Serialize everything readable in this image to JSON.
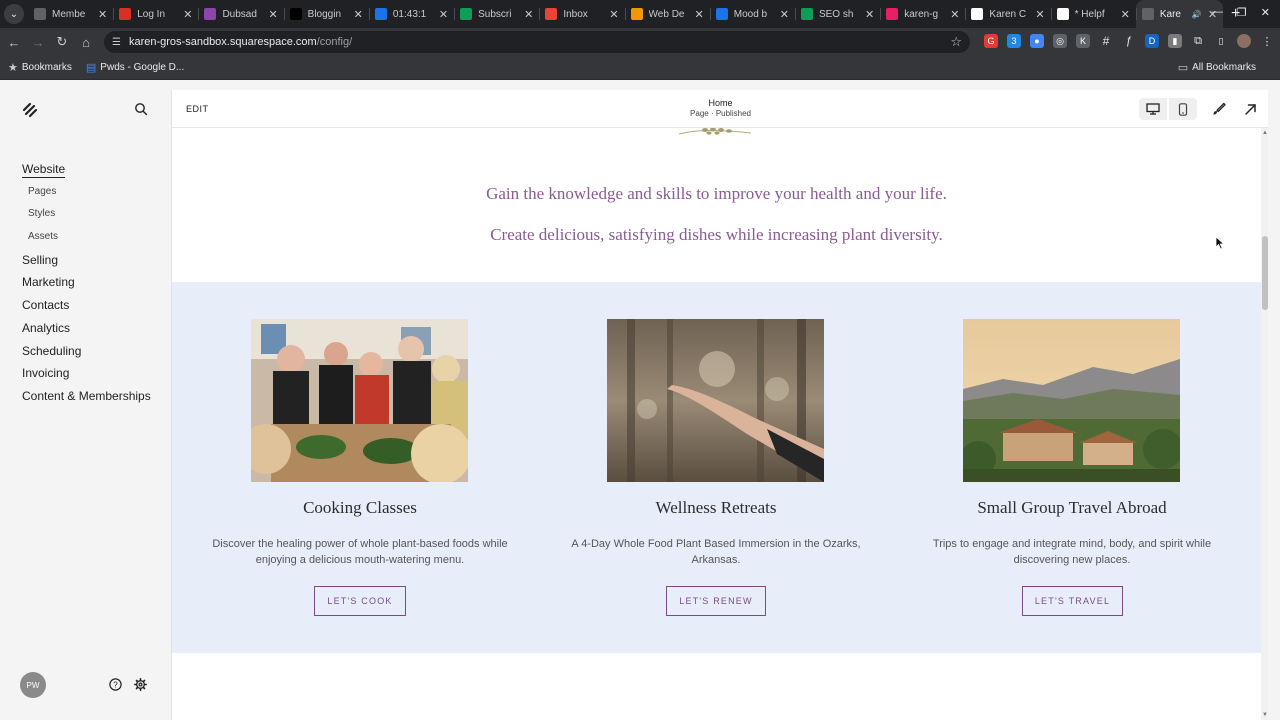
{
  "browser": {
    "tabs": [
      {
        "title": "Membe",
        "color": "#5f6368",
        "active": false
      },
      {
        "title": "Log In",
        "color": "#d93025",
        "active": false
      },
      {
        "title": "Dubsad",
        "color": "#8e44ad",
        "active": false
      },
      {
        "title": "Bloggin",
        "color": "#000000",
        "active": false
      },
      {
        "title": "01:43:1",
        "color": "#1a73e8",
        "active": false
      },
      {
        "title": "Subscri",
        "color": "#0f9d58",
        "active": false
      },
      {
        "title": "Inbox",
        "color": "#ea4335",
        "active": false
      },
      {
        "title": "Web De",
        "color": "#f29900",
        "active": false
      },
      {
        "title": "Mood b",
        "color": "#1a73e8",
        "active": false
      },
      {
        "title": "SEO sh",
        "color": "#0f9d58",
        "active": false
      },
      {
        "title": "karen-g",
        "color": "#e91e63",
        "active": false
      },
      {
        "title": "Karen C",
        "color": "#ffffff",
        "active": false
      },
      {
        "title": "* Helpf",
        "color": "#ffffff",
        "active": false
      },
      {
        "title": "Kare",
        "color": "#5f6368",
        "active": true
      }
    ],
    "url_host": "karen-gros-sandbox.squarespace.com",
    "url_path": "/config/",
    "bookmarks": {
      "bookmarks_label": "Bookmarks",
      "pwds_label": "Pwds - Google D...",
      "all_label": "All Bookmarks"
    }
  },
  "sidebar": {
    "items": [
      {
        "label": "Website",
        "active": true
      },
      {
        "label": "Pages",
        "sub": true
      },
      {
        "label": "Styles",
        "sub": true
      },
      {
        "label": "Assets",
        "sub": true
      },
      {
        "label": "Selling"
      },
      {
        "label": "Marketing"
      },
      {
        "label": "Contacts"
      },
      {
        "label": "Analytics"
      },
      {
        "label": "Scheduling"
      },
      {
        "label": "Invoicing"
      },
      {
        "label": "Content & Memberships"
      }
    ],
    "avatar_initials": "PW"
  },
  "editor": {
    "edit_label": "EDIT",
    "page_title": "Home",
    "page_status": "Page · Published"
  },
  "site": {
    "tagline_1": "Gain the knowledge and skills to improve your health and your life.",
    "tagline_2": "Create delicious, satisfying dishes while increasing plant diversity.",
    "cards": [
      {
        "title": "Cooking Classes",
        "description": "Discover the healing power of whole plant-based foods while enjoying a delicious mouth-watering menu.",
        "button": "LET'S COOK"
      },
      {
        "title": "Wellness Retreats",
        "description": "A 4-Day Whole Food Plant Based Immersion in the Ozarks, Arkansas.",
        "button": "LET'S RENEW"
      },
      {
        "title": "Small Group Travel Abroad",
        "description": "Trips to engage and integrate mind, body, and spirit while discovering new places.",
        "button": "LET'S TRAVEL"
      }
    ]
  },
  "colors": {
    "accent": "#7b4b80",
    "tagline": "#8a5a94",
    "band": "#e8eef9"
  }
}
